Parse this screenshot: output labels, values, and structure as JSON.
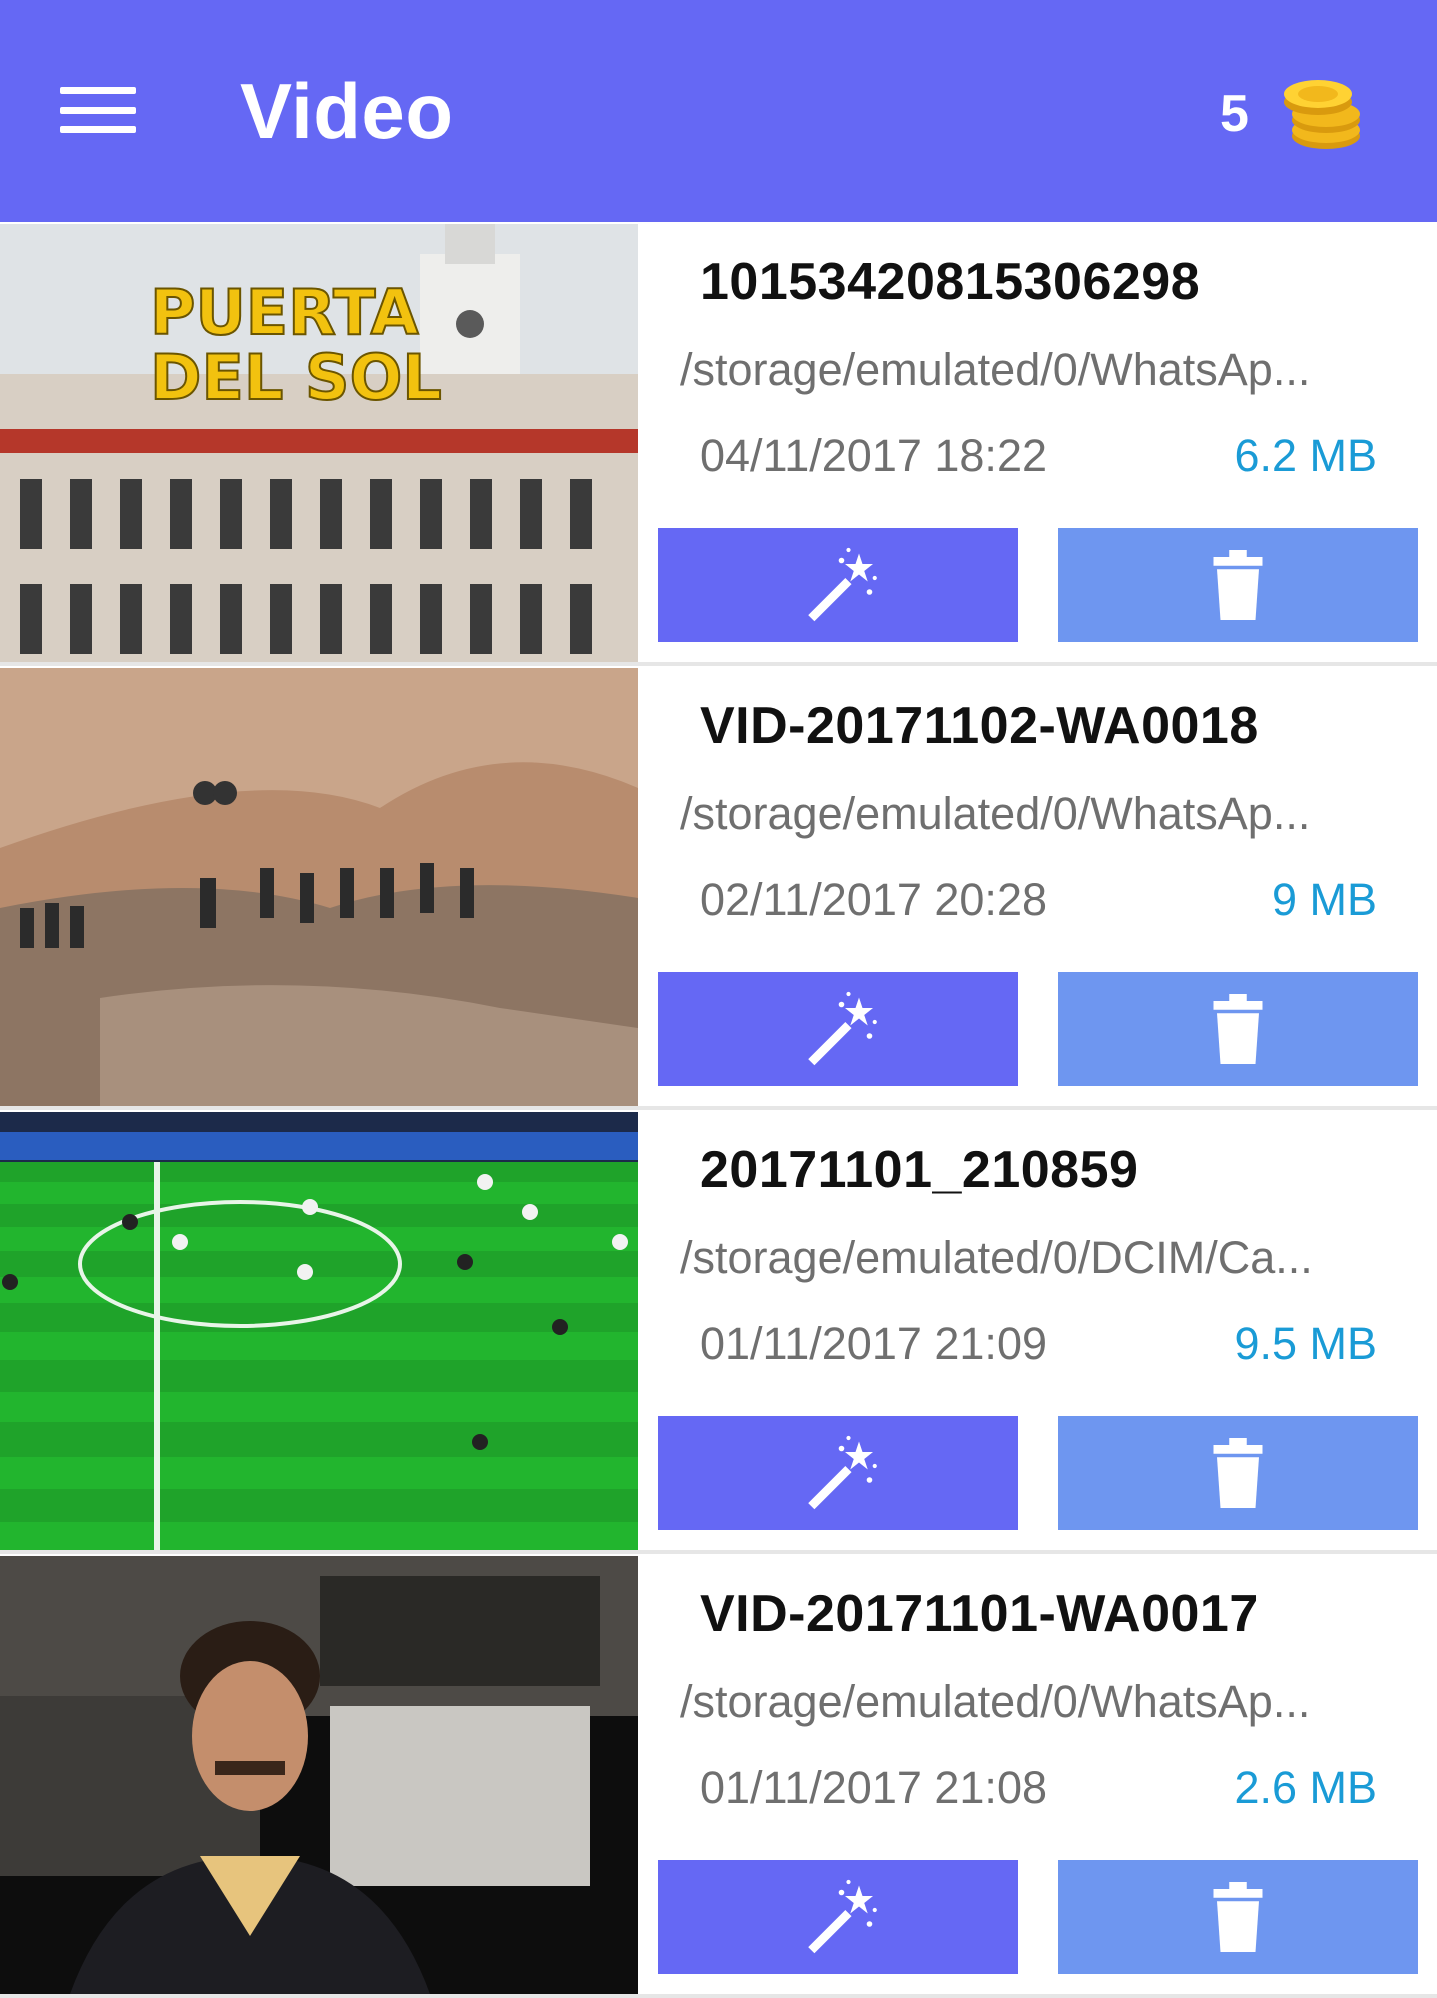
{
  "appbar": {
    "title": "Video",
    "coins": "5",
    "menu_icon": "hamburger-menu-icon",
    "coins_icon": "gold-coins-icon"
  },
  "colors": {
    "primary": "#6568f4",
    "delete_button": "#6e96f0",
    "size_text": "#1a9bd6"
  },
  "videos": [
    {
      "name": "10153420815306298",
      "path": "/storage/emulated/0/WhatsAp...",
      "date": "04/11/2017 18:22",
      "size": "6.2 MB",
      "thumb_text_1": "PUERTA",
      "thumb_text_2": "DEL SOL"
    },
    {
      "name": "VID-20171102-WA0018",
      "path": "/storage/emulated/0/WhatsAp...",
      "date": "02/11/2017 20:28",
      "size": "9 MB"
    },
    {
      "name": "20171101_210859",
      "path": "/storage/emulated/0/DCIM/Ca...",
      "date": "01/11/2017 21:09",
      "size": "9.5 MB"
    },
    {
      "name": "VID-20171101-WA0017",
      "path": "/storage/emulated/0/WhatsAp...",
      "date": "01/11/2017 21:08",
      "size": "2.6 MB"
    }
  ],
  "buttons": {
    "magic_icon": "magic-wand-icon",
    "delete_icon": "trash-icon"
  }
}
